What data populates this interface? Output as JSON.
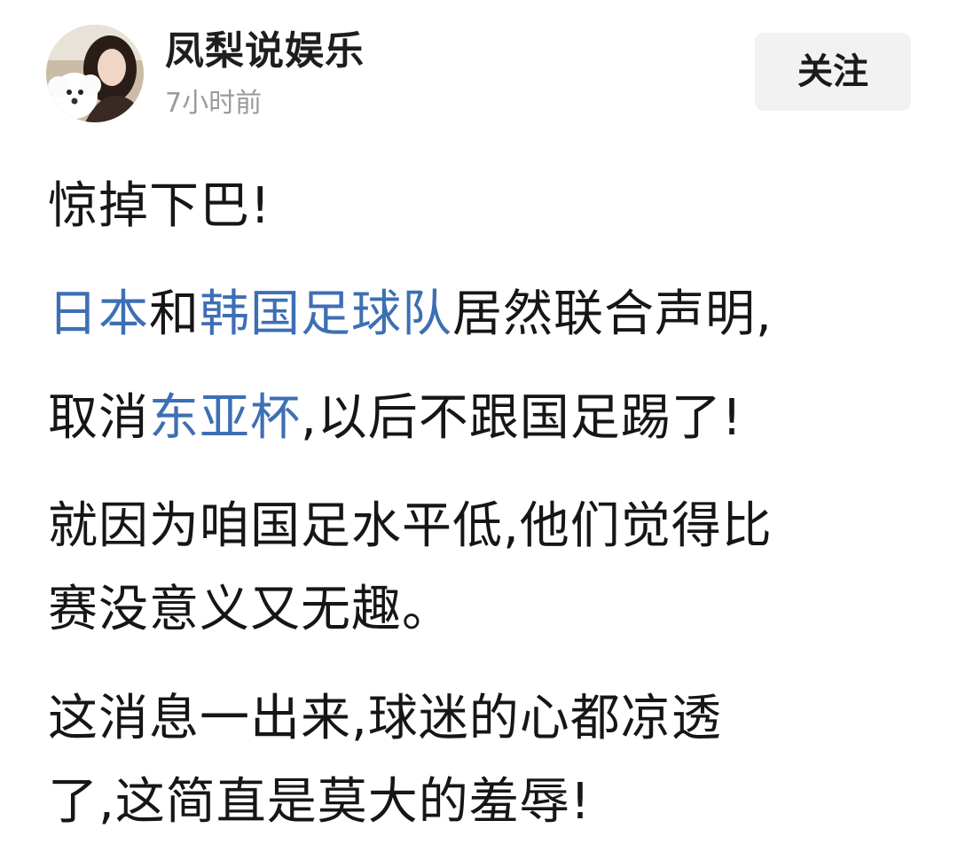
{
  "author": {
    "name": "凤梨说娱乐",
    "time": "7小时前",
    "avatar_icon": "avatar-woman-with-white-dog"
  },
  "follow": {
    "label": "关注"
  },
  "post": {
    "line1": "惊掉下巴!",
    "line2": {
      "link_japan": "日本",
      "and": "和",
      "link_korea_team": "韩国足球队",
      "rest": "居然联合声明,"
    },
    "line3": {
      "prefix": "取消",
      "link_eaf_cup": "东亚杯",
      "rest": ",以后不跟国足踢了!"
    },
    "line4": "就因为咱国足水平低,他们觉得比",
    "line5": "赛没意义又无趣。",
    "line6": "这消息一出来,球迷的心都凉透",
    "line7": "了,这简直是莫大的羞辱!"
  },
  "colors": {
    "link": "#3d6fb3",
    "text": "#161616",
    "meta": "#9a9a9a",
    "button_bg": "#f2f2f2"
  }
}
